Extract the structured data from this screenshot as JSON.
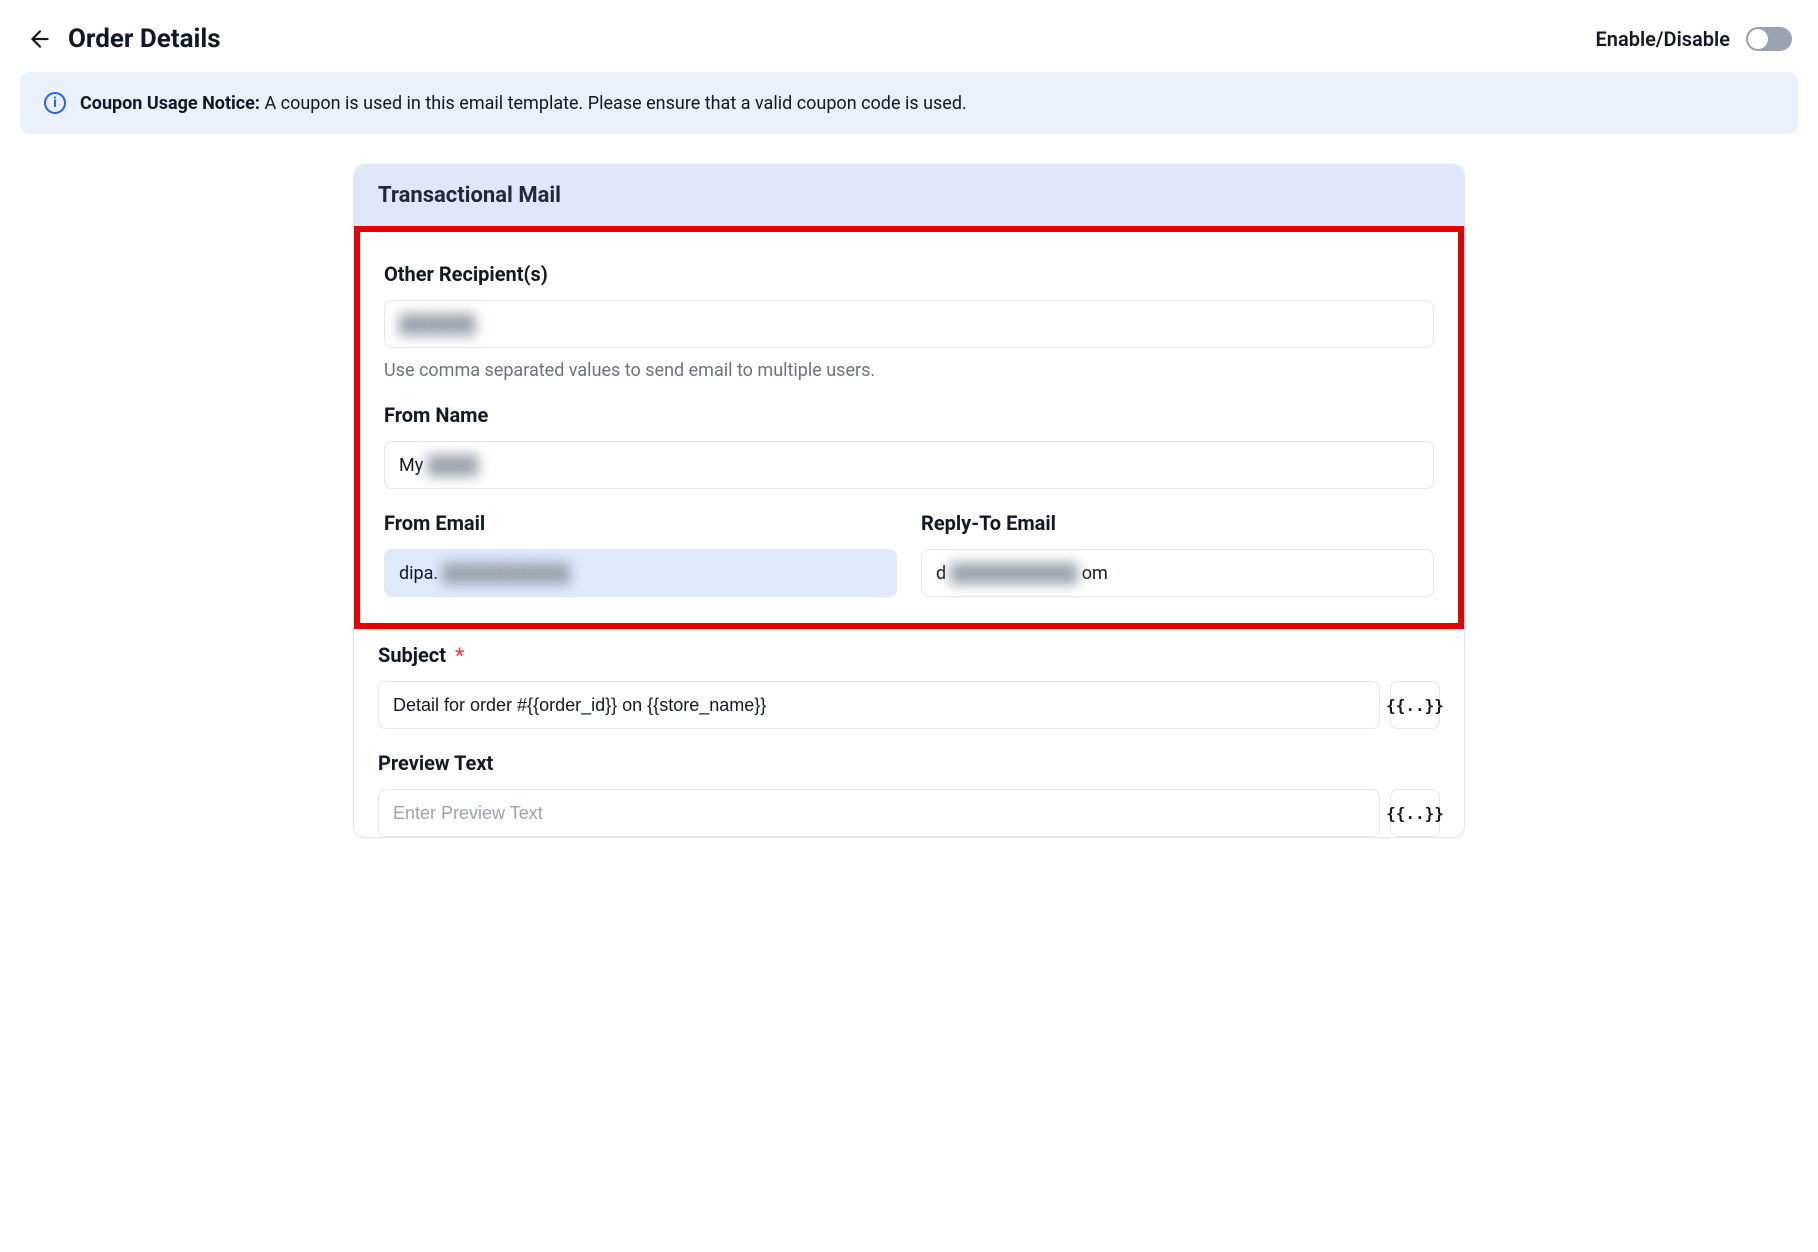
{
  "header": {
    "title": "Order Details",
    "toggle_label": "Enable/Disable",
    "toggle_on": false
  },
  "notice": {
    "title": "Coupon Usage Notice:",
    "body": "A coupon is used in this email template. Please ensure that a valid coupon code is used."
  },
  "card": {
    "title": "Transactional Mail",
    "fields": {
      "other_recipients": {
        "label": "Other Recipient(s)",
        "value": "",
        "hint": "Use comma separated values to send email to multiple users."
      },
      "from_name": {
        "label": "From Name",
        "prefix": "My",
        "blurred_rest": "████"
      },
      "from_email": {
        "label": "From Email",
        "prefix": "dipa.",
        "blurred_rest": "██████████"
      },
      "reply_to_email": {
        "label": "Reply-To Email",
        "prefix": "d",
        "blurred_mid": "██████████",
        "suffix": "om"
      },
      "subject": {
        "label": "Subject",
        "required": true,
        "value": "Detail for order #{{order_id}} on {{store_name}}"
      },
      "preview_text": {
        "label": "Preview Text",
        "placeholder": "Enter Preview Text",
        "value": ""
      }
    },
    "token_button_glyph": "{{..}}"
  }
}
